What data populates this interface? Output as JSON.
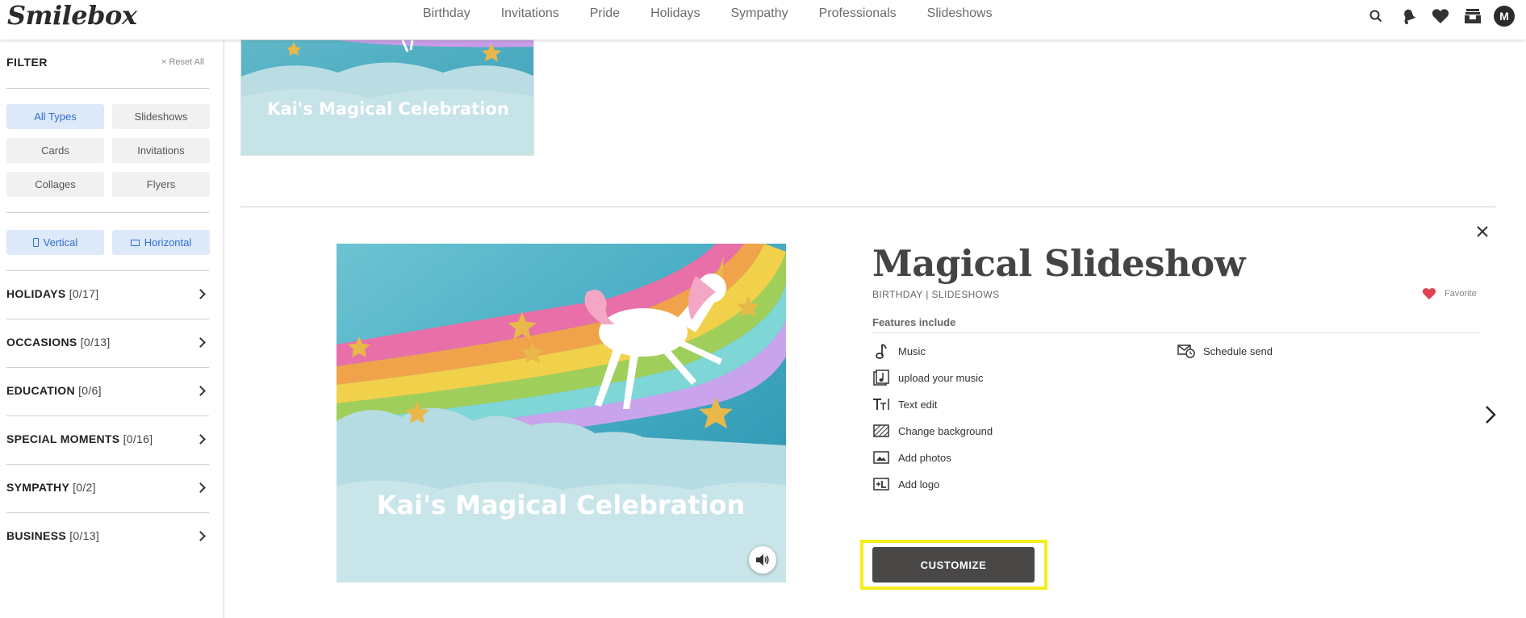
{
  "header": {
    "logo": "Smilebox",
    "nav": [
      "Birthday",
      "Invitations",
      "Pride",
      "Holidays",
      "Sympathy",
      "Professionals",
      "Slideshows"
    ],
    "avatar_initial": "M",
    "icons": [
      "search-icon",
      "bell-icon",
      "heart-icon",
      "inbox-icon"
    ]
  },
  "sidebar": {
    "filter_title": "FILTER",
    "reset_label": "× Reset All",
    "types": [
      "All Types",
      "Slideshows",
      "Cards",
      "Invitations",
      "Collages",
      "Flyers"
    ],
    "active_type": "All Types",
    "orientations": [
      "Vertical",
      "Horizontal"
    ],
    "categories": [
      {
        "label": "HOLIDAYS",
        "count": "[0/17]"
      },
      {
        "label": "OCCASIONS",
        "count": "[0/13]"
      },
      {
        "label": "EDUCATION",
        "count": "[0/6]"
      },
      {
        "label": "SPECIAL MOMENTS",
        "count": "[0/16]"
      },
      {
        "label": "SYMPATHY",
        "count": "[0/2]"
      },
      {
        "label": "BUSINESS",
        "count": "[0/13]"
      }
    ]
  },
  "main": {
    "thumbnail_caption": "Kai's Magical Celebration",
    "preview_caption": "Kai's Magical Celebration",
    "detail": {
      "title": "Magical Slideshow",
      "subtitle": "BIRTHDAY | SLIDESHOWS",
      "favorite_label": "Favorite",
      "features_heading": "Features include",
      "features_left": [
        {
          "label": "Music",
          "icon": "music-note-icon"
        },
        {
          "label": "upload your music",
          "icon": "upload-music-icon"
        },
        {
          "label": "Text edit",
          "icon": "text-edit-icon"
        },
        {
          "label": "Change background",
          "icon": "background-icon"
        },
        {
          "label": "Add photos",
          "icon": "photo-icon"
        },
        {
          "label": "Add logo",
          "icon": "logo-icon"
        }
      ],
      "features_right": [
        {
          "label": "Schedule send",
          "icon": "schedule-send-icon"
        }
      ],
      "customize_label": "CUSTOMIZE"
    }
  },
  "colors": {
    "accent_blue": "#2d6ed1",
    "active_bg": "#dde9f9",
    "button_dark": "#4a4847",
    "highlight_yellow": "#f5ec1d",
    "heart_red": "#e0404f"
  }
}
